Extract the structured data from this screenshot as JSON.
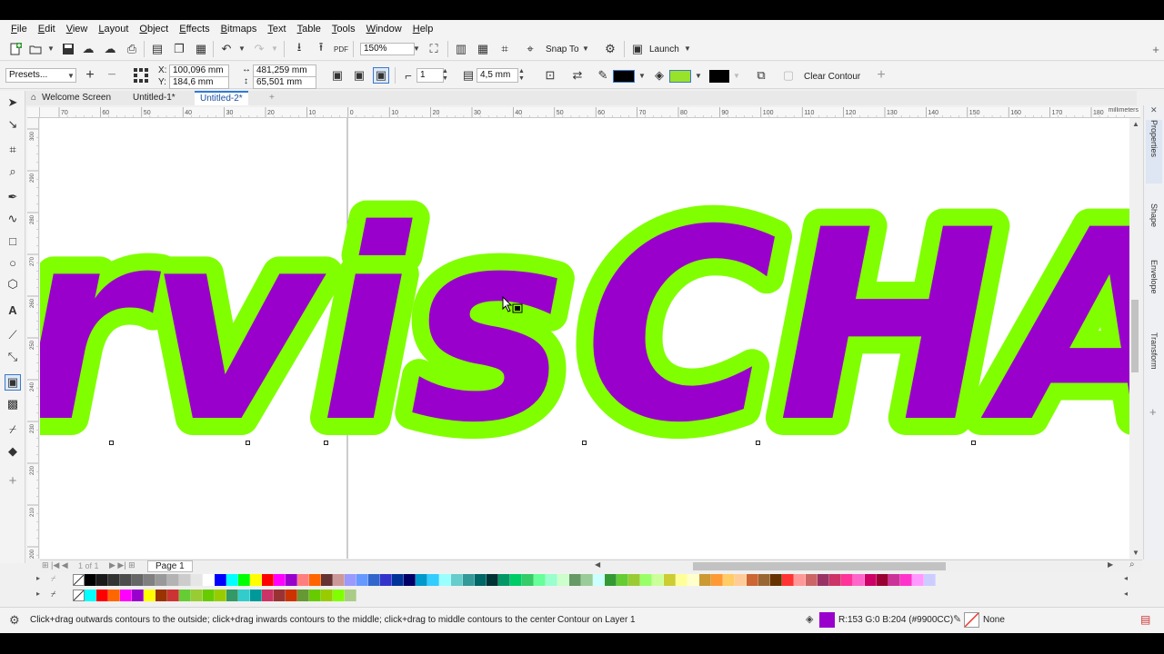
{
  "menu": [
    "File",
    "Edit",
    "View",
    "Layout",
    "Object",
    "Effects",
    "Bitmaps",
    "Text",
    "Table",
    "Tools",
    "Window",
    "Help"
  ],
  "toolbar": {
    "zoom": "150%",
    "snap_to": "Snap To",
    "launch": "Launch",
    "pdf": "PDF"
  },
  "property_bar": {
    "presets": "Presets...",
    "x_label": "X:",
    "y_label": "Y:",
    "x": "100,096 mm",
    "y": "184,6 mm",
    "width": "481,259 mm",
    "height": "65,501 mm",
    "steps": "1",
    "offset": "4,5 mm",
    "clear_contour": "Clear Contour",
    "outline_color": "#000000",
    "fill_color": "#99e22a",
    "contour_color": "#000000"
  },
  "doc_tabs": [
    "Welcome Screen",
    "Untitled-1*",
    "Untitled-2*"
  ],
  "ruler": {
    "h_ticks": [
      "70",
      "60",
      "50",
      "40",
      "30",
      "20",
      "10",
      "0",
      "10",
      "20",
      "30",
      "40",
      "50",
      "60",
      "70",
      "80",
      "90",
      "100",
      "110",
      "120",
      "130",
      "140",
      "150",
      "160",
      "170",
      "180"
    ],
    "h_unit": "millimeters",
    "v_ticks": [
      "200",
      "210",
      "220",
      "230",
      "240",
      "250",
      "260",
      "270",
      "280",
      "290",
      "300"
    ]
  },
  "canvas": {
    "text_left": "rvis",
    "text_right": "CHA",
    "text_color": "#9900cc",
    "contour_color": "#80ff00"
  },
  "page_nav": {
    "page_count": "1 of 1",
    "page_tab": "Page 1"
  },
  "dock_tabs": [
    "Properties",
    "Shape",
    "Envelope",
    "Transform"
  ],
  "palette_row1": [
    "#ffffff",
    "#000000",
    "#1a1a1a",
    "#333333",
    "#4d4d4d",
    "#666666",
    "#808080",
    "#999999",
    "#b3b3b3",
    "#cccccc",
    "#e6e6e6",
    "#ffffff",
    "#0000ff",
    "#00ffff",
    "#00ff00",
    "#ffff00",
    "#ff0000",
    "#ff00ff",
    "#9900cc",
    "#ff7f7f",
    "#ff6600",
    "#663333",
    "#cc9999",
    "#9999ff",
    "#6699ff",
    "#3366cc",
    "#3333cc",
    "#003399",
    "#000066",
    "#0099cc",
    "#33ccff",
    "#99ffff",
    "#66cccc",
    "#339999",
    "#006666",
    "#003333",
    "#009966",
    "#00cc66",
    "#33cc66",
    "#66ff99",
    "#99ffcc",
    "#ccffcc",
    "#669966",
    "#99cc99",
    "#ccffff",
    "#339933",
    "#66cc33",
    "#99cc33",
    "#99ff66",
    "#ccff99",
    "#cccc33",
    "#ffff99",
    "#ffffcc",
    "#cc9933",
    "#ff9933",
    "#ffcc66",
    "#ffcc99",
    "#cc6633",
    "#996633",
    "#663300",
    "#ff3333",
    "#ff9999",
    "#cc6666",
    "#993366",
    "#cc3366",
    "#ff3399",
    "#ff66cc",
    "#cc0066",
    "#990033",
    "#cc3399",
    "#ff33cc",
    "#ff99ff",
    "#ccccff"
  ],
  "palette_row2": [
    "#ffffff",
    "#00ffff",
    "#ff0000",
    "#ff6600",
    "#ff00ff",
    "#9900cc",
    "#ffff00",
    "#993300",
    "#cc3333",
    "#66cc33",
    "#99cc33",
    "#66cc00",
    "#99cc00",
    "#339966",
    "#33cccc",
    "#009999",
    "#cc3366",
    "#993333",
    "#cc3300",
    "#669933",
    "#66cc00",
    "#99cc00",
    "#80ff00",
    "#aacc88"
  ],
  "status": {
    "hint": "Click+drag outwards contours to the outside; click+drag inwards contours to the middle; click+drag to middle contours to the center",
    "layer": "Contour on Layer 1",
    "fill_info": "R:153 G:0 B:204 (#9900CC)",
    "fill_color": "#9900cc",
    "outline": "None"
  }
}
